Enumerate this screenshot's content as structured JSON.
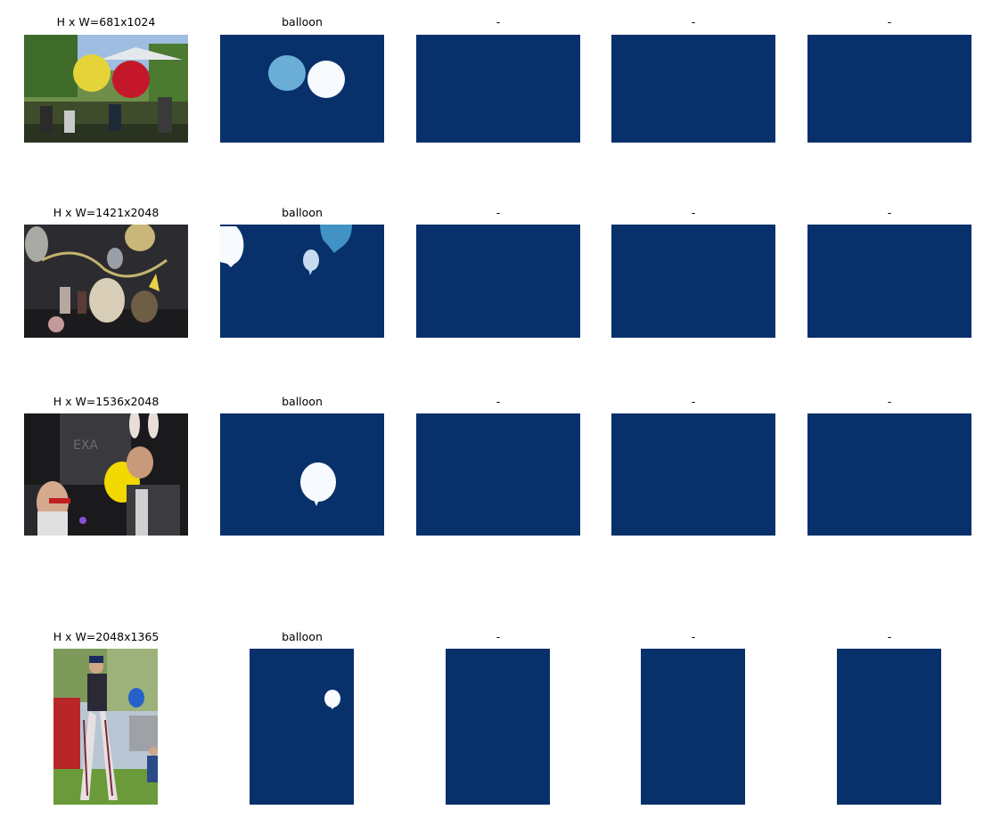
{
  "rows": [
    {
      "photo_title": "H x W=681x1024",
      "mask_titles": [
        "balloon",
        "-",
        "-",
        "-"
      ],
      "photo_desc": "park-balloons",
      "colors": {
        "mask_bg": "#08306b"
      }
    },
    {
      "photo_title": "H x W=1421x2048",
      "mask_titles": [
        "balloon",
        "-",
        "-",
        "-"
      ],
      "photo_desc": "party-pets",
      "colors": {
        "mask_bg": "#08306b"
      }
    },
    {
      "photo_title": "H x W=1536x2048",
      "mask_titles": [
        "balloon",
        "-",
        "-",
        "-"
      ],
      "photo_desc": "graffiti-couple",
      "colors": {
        "mask_bg": "#08306b"
      }
    },
    {
      "photo_title": "H x W=2048x1365",
      "mask_titles": [
        "balloon",
        "-",
        "-",
        "-"
      ],
      "photo_desc": "stilt-walker",
      "colors": {
        "mask_bg": "#08306b"
      }
    }
  ]
}
